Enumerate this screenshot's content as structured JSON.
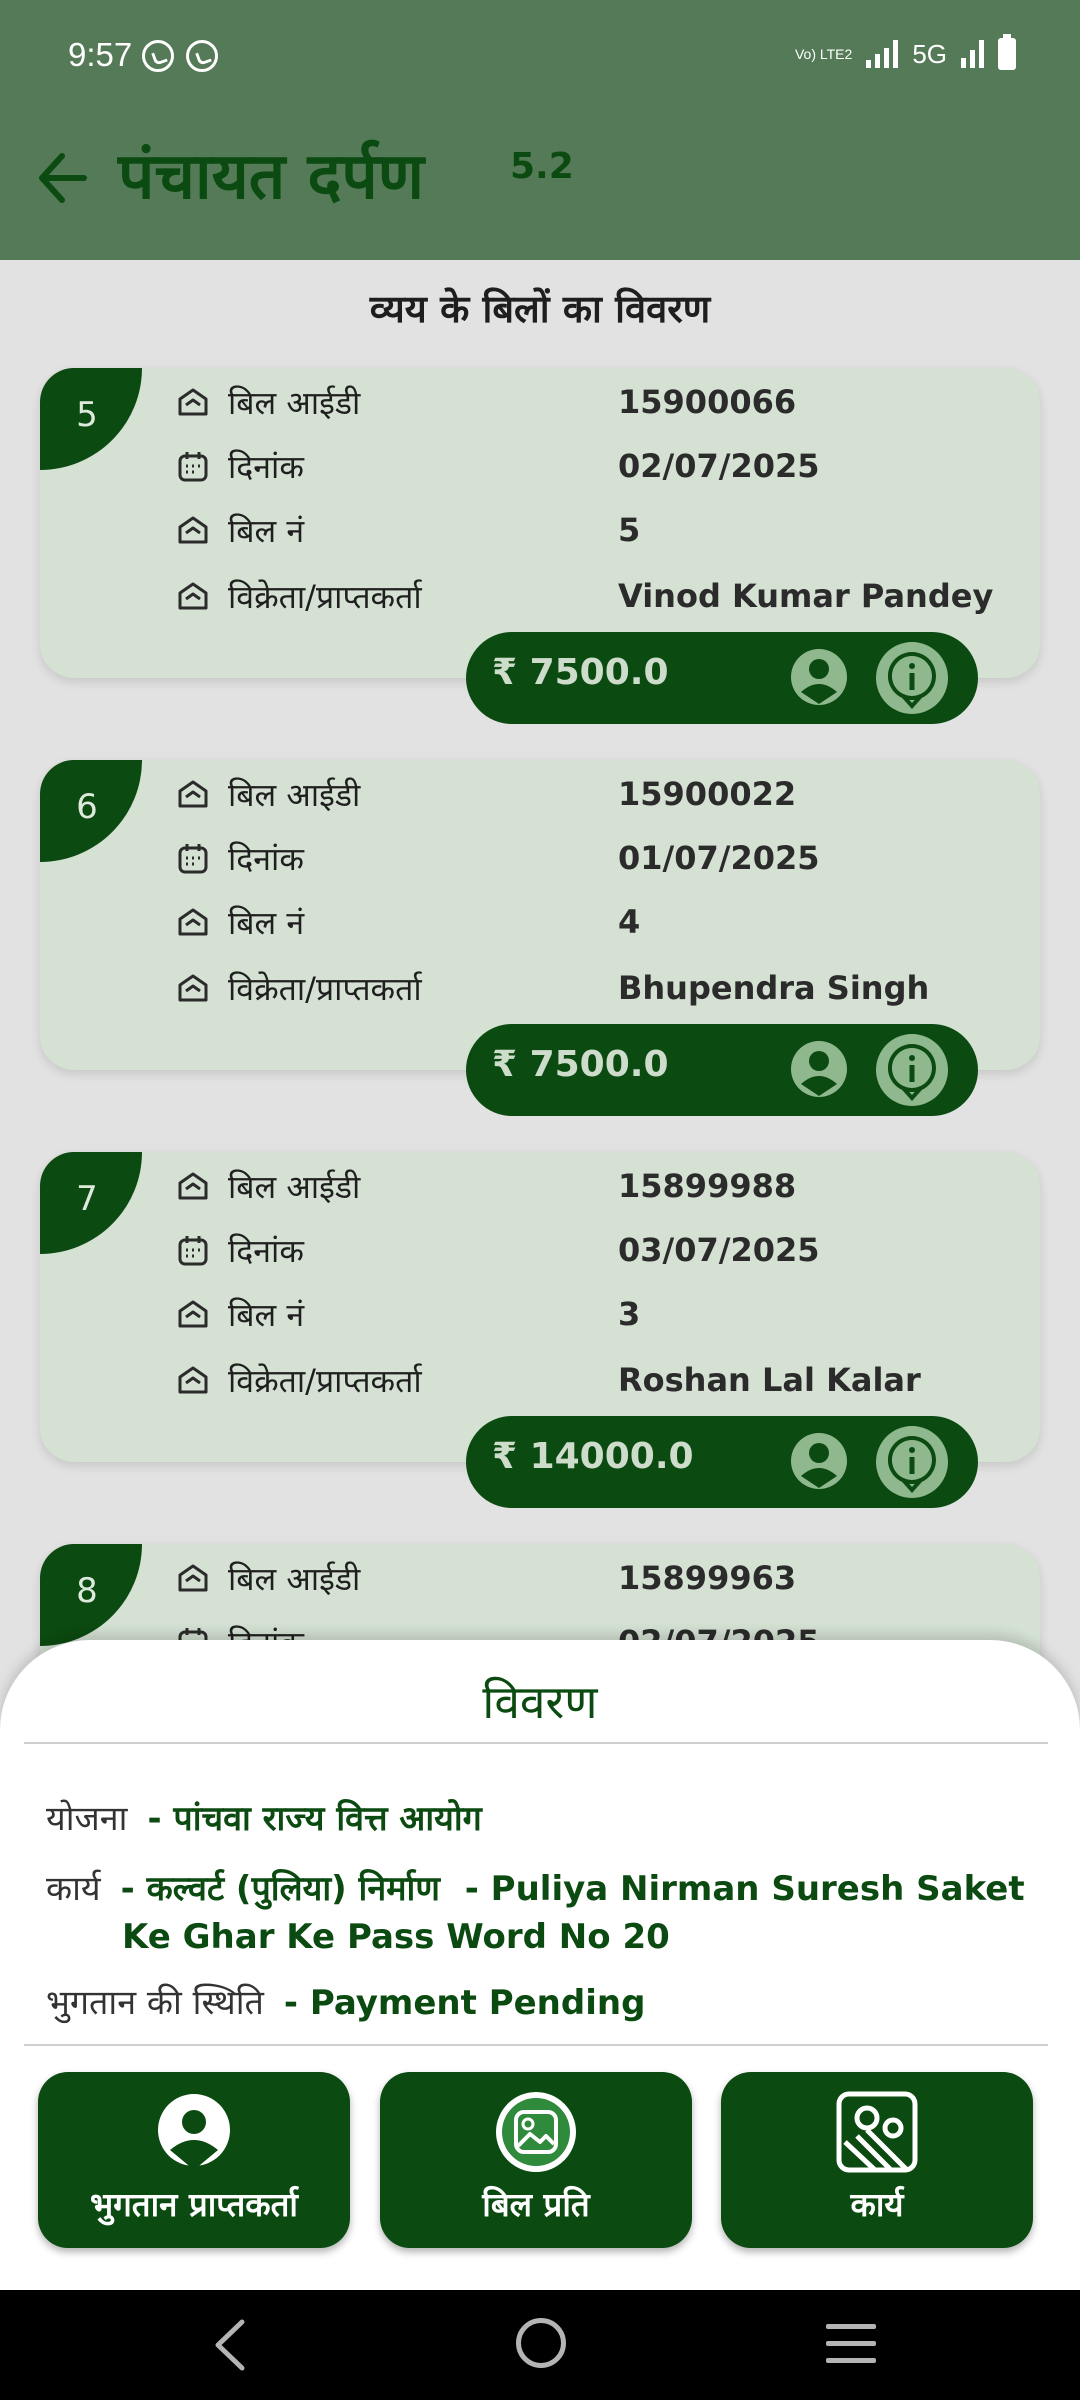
{
  "status_bar": {
    "time": "9:57",
    "network_type": "5G",
    "volte_label": "Vo) LTE2",
    "icons": [
      "whatsapp-icon",
      "whatsapp-icon",
      "signal-icon",
      "battery-icon"
    ]
  },
  "app_bar": {
    "title": "पंचायत दर्पण",
    "version": "5.2",
    "back_icon": "back-arrow-icon"
  },
  "page": {
    "section_title": "व्यय के बिलों का विवरण"
  },
  "labels": {
    "bill_id": "बिल आईडी",
    "date": "दिनांक",
    "bill_no": "बिल नं",
    "vendor": "विक्रेता/प्राप्तकर्ता"
  },
  "bills": [
    {
      "serial": "5",
      "bill_id": "15900066",
      "date": "02/07/2025",
      "bill_no": "5",
      "vendor": "Vinod Kumar Pandey",
      "amount": "₹ 7500.0"
    },
    {
      "serial": "6",
      "bill_id": "15900022",
      "date": "01/07/2025",
      "bill_no": "4",
      "vendor": "Bhupendra Singh",
      "amount": "₹ 7500.0"
    },
    {
      "serial": "7",
      "bill_id": "15899988",
      "date": "03/07/2025",
      "bill_no": "3",
      "vendor": "Roshan Lal Kalar",
      "amount": "₹ 14000.0"
    },
    {
      "serial": "8",
      "bill_id": "15899963",
      "date": "02/07/2025"
    }
  ],
  "sheet": {
    "title": "विवरण",
    "yojana_label": "योजना",
    "yojana_value": "- पांचवा राज्य वित्त आयोग",
    "karya_label": "कार्य",
    "karya_value_hi": "- कल्वर्ट (पुलिया) निर्माण",
    "karya_value_en_1": "- Puliya Nirman Suresh Saket",
    "karya_value_en_2": "Ke Ghar Ke Pass Word No 20",
    "status_label": "भुगतान की स्थिति",
    "status_value": "- Payment Pending",
    "buttons": [
      {
        "label": "भुगतान प्राप्तकर्ता",
        "icon": "payee-person-icon"
      },
      {
        "label": "बिल प्रति",
        "icon": "bill-image-icon"
      },
      {
        "label": "कार्य",
        "icon": "work-map-icon"
      }
    ]
  },
  "colors": {
    "primary_dark": "#0b4a10",
    "app_bar": "#557a57",
    "card_bg": "#d4e1d3",
    "dim_bg": "#e2e2e2"
  }
}
